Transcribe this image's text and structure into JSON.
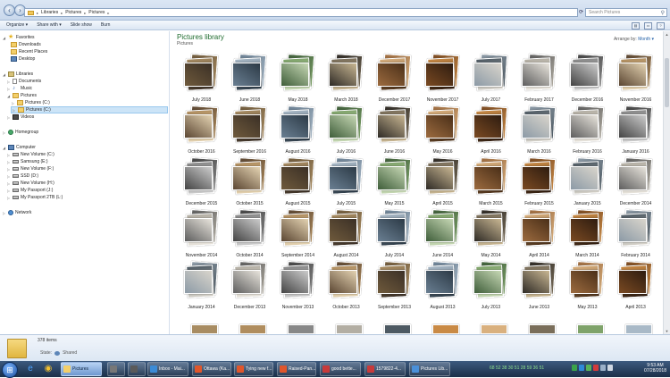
{
  "address": {
    "crumbs": [
      "Libraries",
      "Pictures",
      "Pictures"
    ],
    "search_placeholder": "Search Pictures"
  },
  "toolbar": {
    "organize": "Organize ▾",
    "share_with": "Share with ▾",
    "slide_show": "Slide show",
    "burn": "Burn"
  },
  "nav": {
    "favorites": "Favorites",
    "downloads": "Downloads",
    "recent_places": "Recent Places",
    "desktop": "Desktop",
    "libraries": "Libraries",
    "documents": "Documents",
    "music": "Music",
    "pictures": "Pictures",
    "pictures_c_1": "Pictures (C:)",
    "pictures_c_2": "Pictures (C:)",
    "videos": "Videos",
    "homegroup": "Homegroup",
    "computer": "Computer",
    "drive_c": "New Volume (C:)",
    "drive_e": "Samsung (E:)",
    "drive_f": "New Volume (F:)",
    "drive_d": "SSD (D:)",
    "drive_h": "New Volume (H:)",
    "drive_j": "My Passport (J:)",
    "drive_l": "My Passport 2TB (L:)",
    "network": "Network"
  },
  "library": {
    "title": "Pictures library",
    "subtitle": "Pictures",
    "arrange_label": "Arrange by:",
    "arrange_value": "Month ▾"
  },
  "tiles": [
    "July 2018",
    "June 2018",
    "May 2018",
    "March 2018",
    "December 2017",
    "November 2017",
    "July 2017",
    "February 2017",
    "December 2016",
    "November 2016",
    "October 2016",
    "September 2016",
    "August 2016",
    "July 2016",
    "June 2016",
    "May 2016",
    "April 2016",
    "March 2016",
    "February 2016",
    "January 2016",
    "December 2015",
    "October 2015",
    "August 2015",
    "July 2015",
    "May 2015",
    "April 2015",
    "March 2015",
    "February 2015",
    "January 2015",
    "December 2014",
    "November 2014",
    "October 2014",
    "September 2014",
    "August 2014",
    "July 2014",
    "June 2014",
    "May 2014",
    "April 2014",
    "March 2014",
    "February 2014",
    "January 2014",
    "December 2013",
    "November 2013",
    "October 2013",
    "September 2013",
    "August 2013",
    "July 2013",
    "June 2013",
    "May 2013",
    "April 2013"
  ],
  "details": {
    "count": "378 items",
    "state_label": "State:",
    "state_value": "Shared"
  },
  "taskbar": {
    "buttons": [
      "Pictures",
      "",
      "",
      "Inbox - Mai...",
      "Ottawa (Ka...",
      "Tying new f...",
      "Raised-Pan...",
      "good bette...",
      "1579822-4...",
      "Pictures Lib..."
    ],
    "tray_numbers": "68  52  38  30  51  28  59  36  51",
    "time": "9:53 AM",
    "date": "07/28/2018"
  },
  "colors": {
    "title_green": "#1e6b2e",
    "selection": "#cce4f7",
    "taskbar": "#1b2f48"
  }
}
